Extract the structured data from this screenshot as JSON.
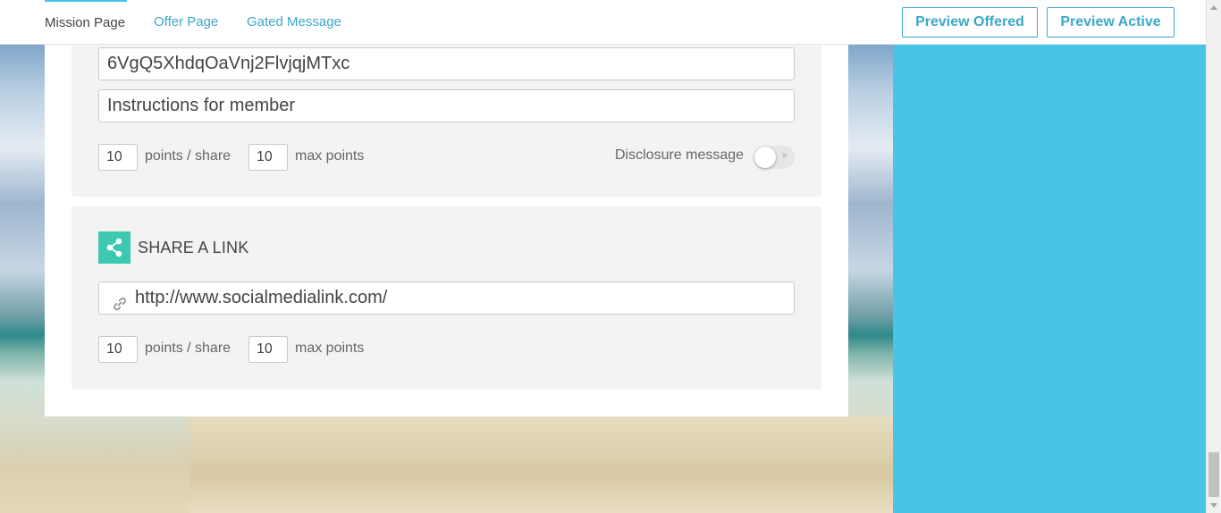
{
  "nav": {
    "tabs": [
      {
        "label": "Mission Page",
        "active": true
      },
      {
        "label": "Offer Page",
        "active": false
      },
      {
        "label": "Gated Message",
        "active": false
      }
    ],
    "preview_offered": "Preview Offered",
    "preview_active": "Preview Active"
  },
  "section1": {
    "code_value": "6VgQ5XhdqOaVnj2FlvjqjMTxc",
    "instructions_value": "Instructions for member",
    "points_per_share": "10",
    "points_per_share_label": "points / share",
    "max_points": "10",
    "max_points_label": "max points",
    "disclosure_label": "Disclosure message",
    "disclosure_enabled": false,
    "toggle_off_glyph": "×"
  },
  "section2": {
    "title": "SHARE A LINK",
    "icon": "share-icon",
    "url_value": "http://www.socialmedialink.com/",
    "url_icon": "link-icon",
    "points_per_share": "10",
    "points_per_share_label": "points / share",
    "max_points": "10",
    "max_points_label": "max points"
  },
  "colors": {
    "accent": "#3ca8c8",
    "panel": "#47c4e6",
    "share_icon_bg": "#3cc9b0"
  }
}
